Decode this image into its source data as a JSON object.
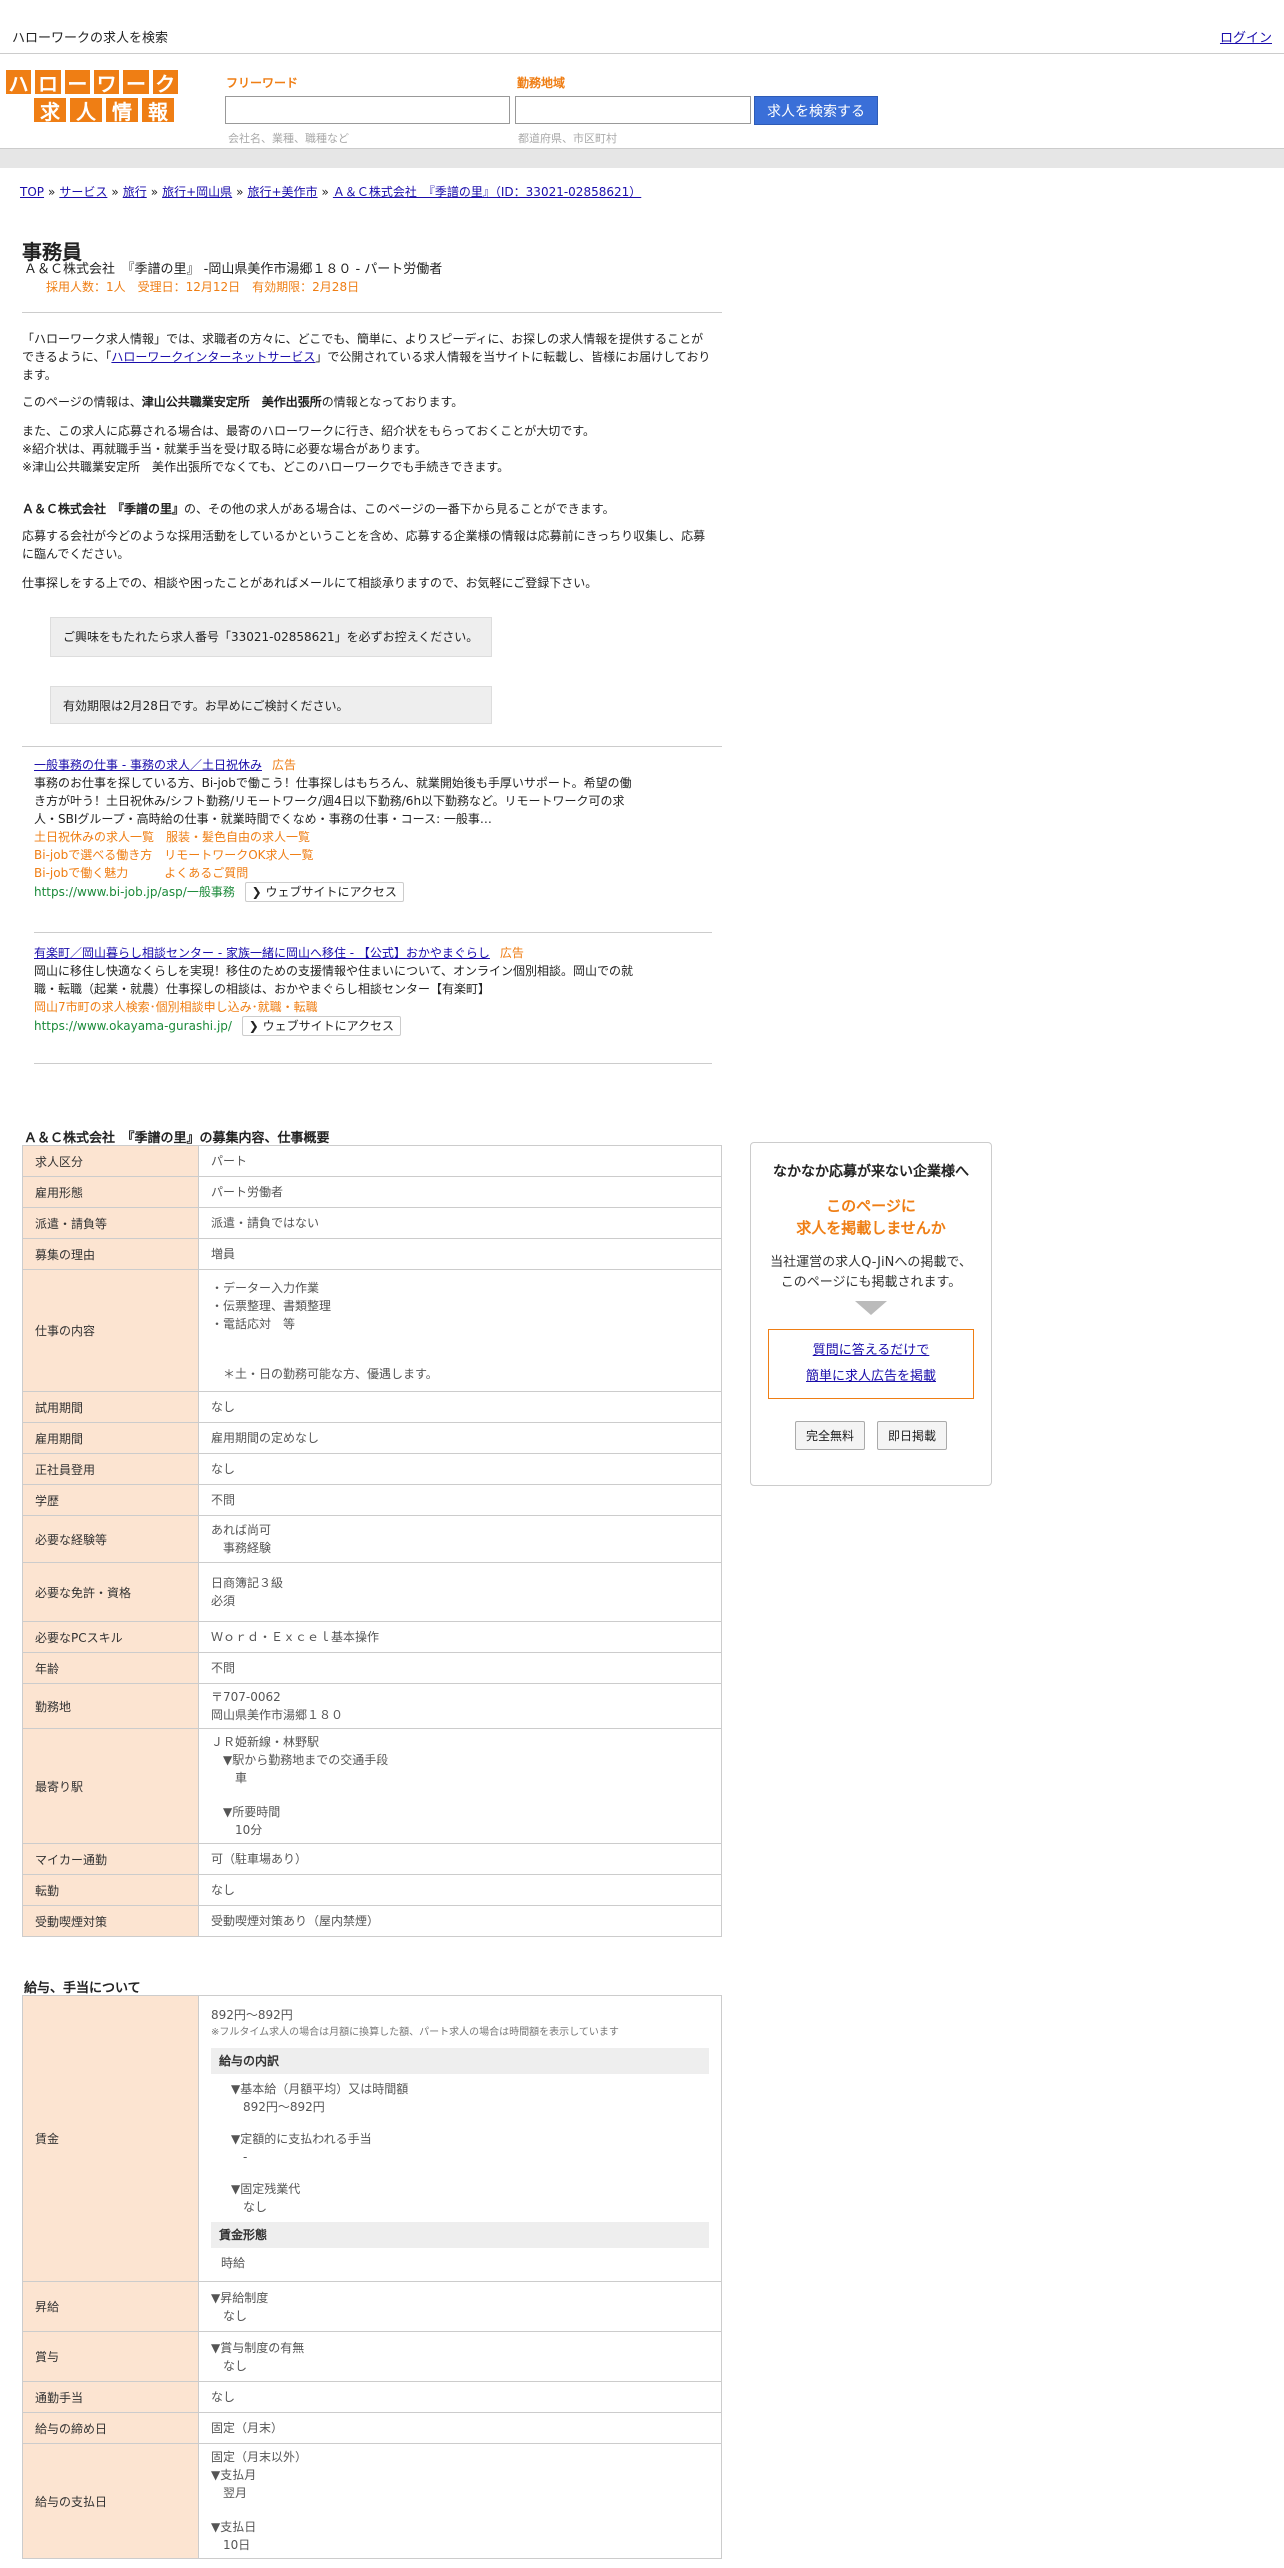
{
  "header": {
    "site_label": "ハローワークの求人を検索",
    "login": "ログイン"
  },
  "logo": {
    "row1": [
      "ハ",
      "ロ",
      "ー",
      "ワ",
      "ー",
      "ク"
    ],
    "row2": [
      "求",
      "人",
      "情",
      "報"
    ]
  },
  "search": {
    "keyword_label": "フリーワード",
    "keyword_hint": "会社名、業種、職種など",
    "area_label": "勤務地域",
    "area_hint": "都道府県、市区町村",
    "button": "求人を検索する"
  },
  "breadcrumb": [
    "TOP",
    "サービス",
    "旅行",
    "旅行+岡山県",
    "旅行+美作市",
    "Ａ＆Ｃ株式会社　『季譜の里』（ID：33021-02858621）"
  ],
  "job": {
    "title": "事務員",
    "subtitle": "Ａ＆Ｃ株式会社　『季譜の里』 -岡山県美作市湯郷１８０ - パート労働者",
    "meta": "採用人数：1人　受理日：12月12日　有効期限：2月28日"
  },
  "intro": {
    "p1_a": "「ハローワーク求人情報」では、求職者の方々に、どこでも、簡単に、よりスピーディに、お探しの求人情報を提供することができるように、「",
    "p1_link": "ハローワークインターネットサービス",
    "p1_b": "」で公開されている求人情報を当サイトに転載し、皆様にお届けしております。",
    "p2_a": "このページの情報は、",
    "p2_b": "津山公共職業安定所　美作出張所",
    "p2_c": "の情報となっております。",
    "p3": [
      "また、この求人に応募される場合は、最寄のハローワークに行き、紹介状をもらっておくことが大切です。",
      "※紹介状は、再就職手当・就業手当を受け取る時に必要な場合があります。",
      "※津山公共職業安定所　美作出張所でなくても、どこのハローワークでも手続きできます。"
    ],
    "p4_a": "Ａ＆Ｃ株式会社　『季譜の里』",
    "p4_b": "の、その他の求人がある場合は、このページの一番下から見ることができます。",
    "p5": "応募する会社が今どのような採用活動をしているかということを含め、応募する企業様の情報は応募前にきっちり収集し、応募に臨んでください。",
    "p6": "仕事探しをする上での、相談や困ったことがあればメールにて相談承りますので、お気軽にご登録下さい。"
  },
  "notices": [
    "ご興味をもたれたら求人番号「33021-02858621」を必ずお控えください。",
    "有効期限は2月28日です。お早めにご検討ください。"
  ],
  "ads": [
    {
      "headline": "一般事務の仕事 - 事務の求人／土日祝休み",
      "tag": "広告",
      "body": "事務のお仕事を探している方、Bi-jobで働こう！仕事探しはもちろん、就業開始後も手厚いサポート。希望の働き方が叶う！土日祝休み/シフト勤務/リモートワーク/週4日以下勤務/6h以下勤務など。リモートワーク可の求人・SBIグループ・高時給の仕事・就業時間でくなめ・事務の仕事・コース: 一般事…",
      "links": [
        "土日祝休みの求人一覧　服装・髪色自由の求人一覧",
        "Bi-jobで選べる働き方　リモートワークOK求人一覧",
        "Bi-jobで働く魅力　　　よくあるご質問"
      ],
      "url": "https://www.bi-job.jp/asp/一般事務",
      "cta": "ウェブサイトにアクセス"
    },
    {
      "headline": "有楽町／岡山暮らし相談センター - 家族一緒に岡山へ移住 - 【公式】おかやまぐらし",
      "tag": "広告",
      "body": "岡山に移住し快適なくらしを実現！移住のための支援情報や住まいについて、オンライン個別相談。岡山での就職・転職（起業・就農）仕事探しの相談は、おかやまぐらし相談センター【有楽町】",
      "links": [
        "岡山7市町の求人検索･個別相談申し込み･就職・転職"
      ],
      "url": "https://www.okayama-gurashi.jp/",
      "cta": "ウェブサイトにアクセス"
    }
  ],
  "section1_title": "Ａ＆Ｃ株式会社　『季譜の里』の募集内容、仕事概要",
  "rows1": [
    {
      "k": "求人区分",
      "v": [
        "パート"
      ]
    },
    {
      "k": "雇用形態",
      "v": [
        "パート労働者"
      ]
    },
    {
      "k": "派遣・請負等",
      "v": [
        "派遣・請負ではない"
      ]
    },
    {
      "k": "募集の理由",
      "v": [
        "増員"
      ]
    },
    {
      "k": "仕事の内容",
      "v": [
        "・データー入力作業",
        "・伝票整理、書類整理",
        "・電話応対　等",
        "",
        "",
        "　＊土・日の勤務可能な方、優遇します。"
      ]
    },
    {
      "k": "試用期間",
      "v": [
        "なし"
      ]
    },
    {
      "k": "雇用期間",
      "v": [
        "雇用期間の定めなし"
      ]
    },
    {
      "k": "正社員登用",
      "v": [
        "なし"
      ]
    },
    {
      "k": "学歴",
      "v": [
        "不問"
      ]
    },
    {
      "k": "必要な経験等",
      "v": [
        "あれば尚可",
        "　事務経験"
      ]
    },
    {
      "k": "必要な免許・資格",
      "v": [
        "日商簿記３級",
        "必須"
      ]
    },
    {
      "k": "必要なPCスキル",
      "v": [
        "Ｗｏｒｄ・Ｅｘｃｅｌ基本操作"
      ]
    },
    {
      "k": "年齢",
      "v": [
        "不問"
      ]
    },
    {
      "k": "勤務地",
      "v": [
        "〒707-0062",
        "岡山県美作市湯郷１８０"
      ]
    },
    {
      "k": "最寄り駅",
      "v": [
        "ＪＲ姫新線・林野駅",
        "　▼駅から勤務地までの交通手段",
        "　　車",
        "",
        "　▼所要時間",
        "　　10分"
      ]
    },
    {
      "k": "マイカー通勤",
      "v": [
        "可（駐車場あり）"
      ]
    },
    {
      "k": "転勤",
      "v": [
        "なし"
      ]
    },
    {
      "k": "受動喫煙対策",
      "v": [
        "受動喫煙対策あり（屋内禁煙）"
      ]
    }
  ],
  "section2_title": "給与、手当について",
  "wage": {
    "k": "賃金",
    "range": "892円〜892円",
    "note": "※フルタイム求人の場合は月額に換算した額、パート求人の場合は時間額を表示しています",
    "breakdown_hd": "給与の内訳",
    "items": [
      "▼基本給（月額平均）又は時間額",
      "　892円〜892円",
      "",
      "▼定額的に支払われる手当",
      "　-",
      "",
      "▼固定残業代",
      "　なし"
    ],
    "form_hd": "賃金形態",
    "form": "時給"
  },
  "rows2": [
    {
      "k": "昇給",
      "v": [
        "▼昇給制度",
        "　なし"
      ]
    },
    {
      "k": "賞与",
      "v": [
        "▼賞与制度の有無",
        "　なし"
      ]
    },
    {
      "k": "通勤手当",
      "v": [
        "なし"
      ]
    },
    {
      "k": "給与の締め日",
      "v": [
        "固定（月末）"
      ]
    },
    {
      "k": "給与の支払日",
      "v": [
        "固定（月末以外）",
        "▼支払月",
        "　翌月",
        "",
        "▼支払日",
        "　10日"
      ]
    }
  ],
  "side": {
    "t1": "なかなか応募が来ない企業様へ",
    "t2a": "このページに",
    "t2b": "求人を掲載しませんか",
    "t3a": "当社運営の求人Q-JiNへの掲載で、",
    "t3b": "このページにも掲載されます。",
    "link1": "質問に答えるだけで",
    "link2": "簡単に求人広告を掲載",
    "btn1": "完全無料",
    "btn2": "即日掲載"
  }
}
